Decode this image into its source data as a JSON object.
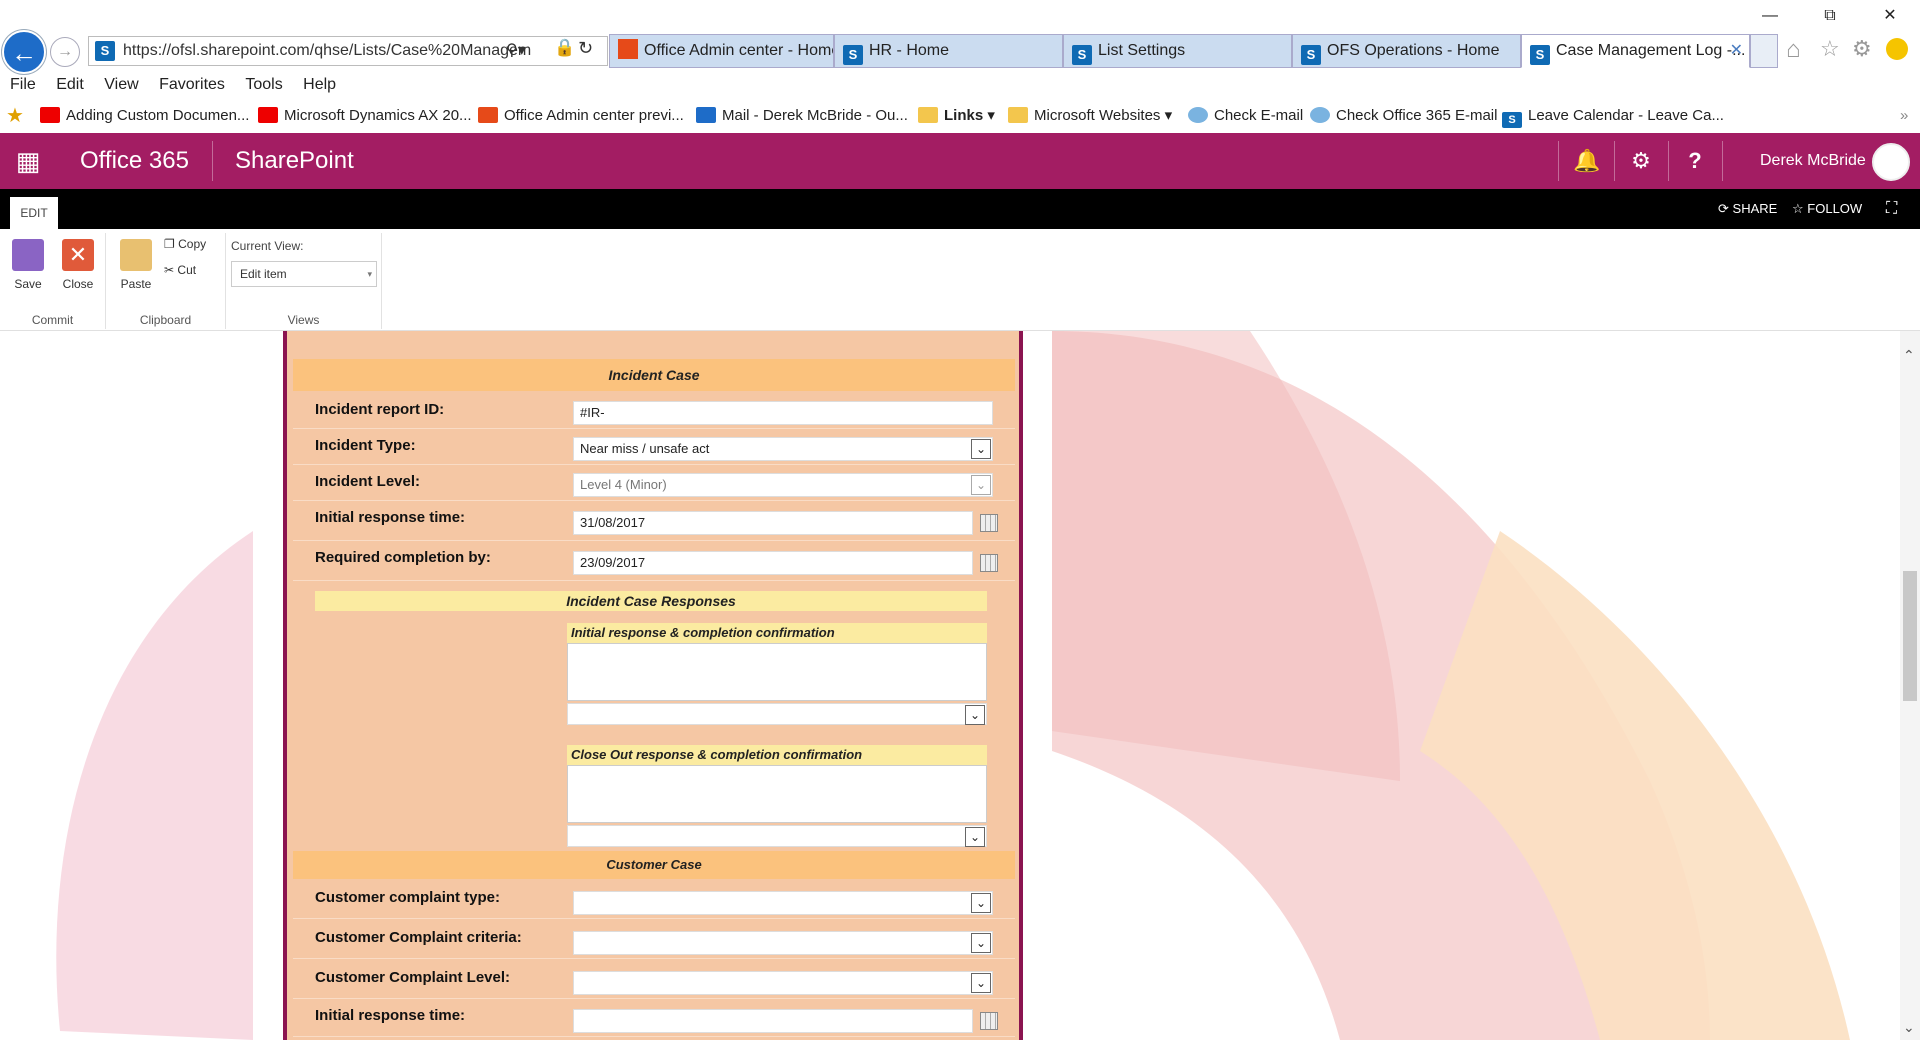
{
  "browser": {
    "address": "https://ofsl.sharepoint.com/qhse/Lists/Case%20Managem",
    "tabs": [
      {
        "label": "Office Admin center - Home",
        "active": false
      },
      {
        "label": "HR - Home",
        "active": false
      },
      {
        "label": "List Settings",
        "active": false
      },
      {
        "label": "OFS Operations - Home",
        "active": false
      },
      {
        "label": "Case Management Log -...",
        "active": true
      }
    ],
    "menu": [
      "File",
      "Edit",
      "View",
      "Favorites",
      "Tools",
      "Help"
    ],
    "favorites": [
      "Adding Custom Documen...",
      "Microsoft Dynamics AX 20...",
      "Office Admin center previ...",
      "Mail - Derek McBride - Ou...",
      "Links",
      "Microsoft Websites",
      "Check E-mail",
      "Check Office 365 E-mail",
      "Leave Calendar - Leave Ca..."
    ]
  },
  "suite": {
    "brand": "Office 365",
    "app": "SharePoint",
    "user": "Derek McBride",
    "accent": "#a31d63"
  },
  "ribbon": {
    "tab": "EDIT",
    "share": "SHARE",
    "follow": "FOLLOW",
    "save": "Save",
    "close": "Close",
    "paste": "Paste",
    "copy": "Copy",
    "cut": "Cut",
    "current_view_label": "Current View:",
    "current_view": "Edit item",
    "groups": {
      "commit": "Commit",
      "clipboard": "Clipboard",
      "views": "Views"
    }
  },
  "form": {
    "incident_header": "Incident Case",
    "incident_report_id_label": "Incident report ID:",
    "incident_report_id": "#IR-",
    "incident_type_label": "Incident Type:",
    "incident_type": "Near miss / unsafe act",
    "incident_level_label": "Incident Level:",
    "incident_level": "Level 4 (Minor)",
    "initial_response_label": "Initial response time:",
    "initial_response": "31/08/2017",
    "required_completion_label": "Required completion by:",
    "required_completion": "23/09/2017",
    "responses_header": "Incident Case Responses",
    "initial_response_confirm": "Initial response  & completion confirmation",
    "close_out_confirm": "Close Out response & completion confirmation",
    "customer_header": "Customer Case",
    "customer_type_label": "Customer complaint type:",
    "customer_criteria_label": "Customer Complaint criteria:",
    "customer_level_label": "Customer Complaint Level:",
    "customer_initial_response_label": "Initial response time:"
  }
}
